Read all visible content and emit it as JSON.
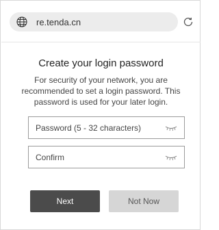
{
  "browser": {
    "url": "re.tenda.cn",
    "globe_icon": "globe-icon",
    "reload_icon": "reload-icon"
  },
  "dialog": {
    "title": "Create your login password",
    "description": "For security of your network, you are recommended to set a login password. This password is used for your later login."
  },
  "form": {
    "password_placeholder": "Password (5 - 32 characters)",
    "confirm_placeholder": "Confirm",
    "eye_icon": "eye-closed-icon"
  },
  "actions": {
    "next_label": "Next",
    "not_now_label": "Not Now"
  },
  "colors": {
    "primary_button": "#4b4b4b",
    "secondary_button": "#d6d6d6",
    "url_bar": "#ececec"
  }
}
